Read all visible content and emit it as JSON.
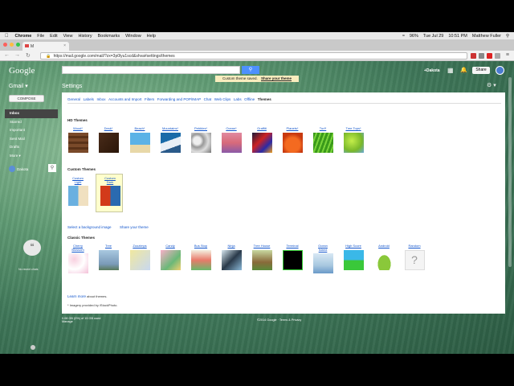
{
  "menubar": {
    "app": "Chrome",
    "items": [
      "File",
      "Edit",
      "View",
      "History",
      "Bookmarks",
      "Window",
      "Help"
    ],
    "status": [
      "96%",
      "Tue Jul 29",
      "10:51 PM",
      "Matthew Fuller"
    ]
  },
  "browser": {
    "tab_title": "M",
    "url": "https://mail.google.com/mail/?zx=3p0lyu1scd&shva#settings/themes"
  },
  "header": {
    "logo": "Google",
    "toast_text": "Custom theme saved.",
    "toast_link": "Share your theme",
    "user": "+Dakota",
    "share": "Share"
  },
  "left": {
    "gmail": "Gmail ▾",
    "compose": "COMPOSE",
    "nav": [
      "Inbox",
      "Starred",
      "Important",
      "Sent Mail",
      "Drafts",
      "More ▾"
    ],
    "hangout_user": "Dakota",
    "chat_text": "No recent chats"
  },
  "settings": {
    "title": "Settings",
    "tabs": [
      "General",
      "Labels",
      "Inbox",
      "Accounts and Import",
      "Filters",
      "Forwarding and POP/IMAP",
      "Chat",
      "Web Clips",
      "Labs",
      "Offline",
      "Themes"
    ],
    "active_tab": "Themes",
    "hd_heading": "HD Themes",
    "hd_themes": [
      "Wood*",
      "Desk*",
      "Beach*",
      "Mountains*",
      "Pebbles*",
      "Ocean*",
      "Graffiti",
      "Planets*",
      "Turf*",
      "Tree Tops*"
    ],
    "custom_heading": "Custom Themes",
    "custom_themes": [
      "Custom Light",
      "Custom Dark"
    ],
    "select_bg": "Select a background image",
    "share_theme": "Share your theme",
    "classic_heading": "Classic Themes",
    "classic_themes": [
      "Cherry Blossom",
      "Tree",
      "Zoozimps",
      "Candy",
      "Bus Stop",
      "Ninja",
      "Tree House",
      "Terminal",
      "Ocean Island",
      "High Score",
      "Android",
      "Random"
    ],
    "learn_more": "Learn more",
    "learn_more_suffix": " about themes.",
    "imagery": "* Imagery provided by iStockPhoto."
  },
  "footer": {
    "storage": "0.08 GB (0%) of 15 GB used",
    "manage": "Manage",
    "copyright": "©2014 Google · Terms & Privacy"
  },
  "colors": {
    "accent": "#4d90fe",
    "link": "#1155cc",
    "toast_bg": "#f9edbe"
  }
}
